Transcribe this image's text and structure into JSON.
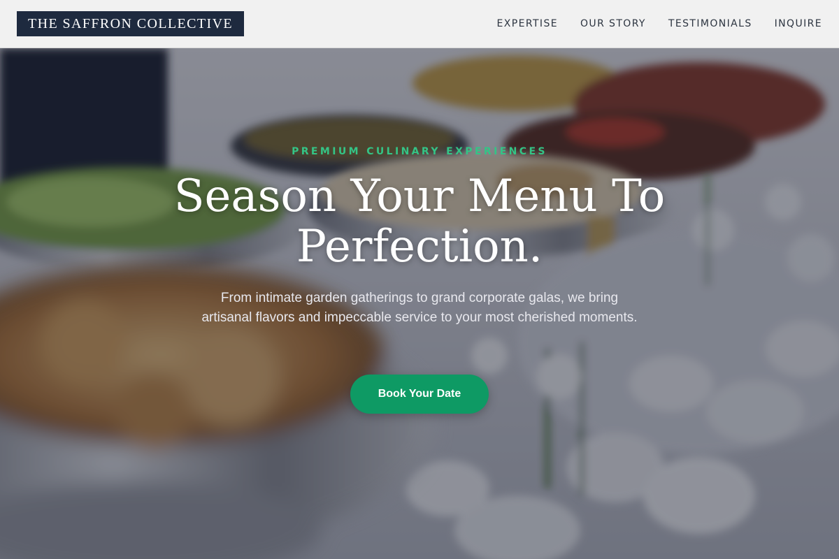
{
  "brand": {
    "name": "THE SAFFRON COLLECTIVE"
  },
  "nav": {
    "items": [
      {
        "label": "EXPERTISE"
      },
      {
        "label": "OUR STORY"
      },
      {
        "label": "TESTIMONIALS"
      },
      {
        "label": "INQUIRE"
      }
    ]
  },
  "hero": {
    "eyebrow": "PREMIUM CULINARY EXPERIENCES",
    "headline": "Season Your Menu To Perfection.",
    "subtext": "From intimate garden gatherings to grand corporate galas, we bring artisanal flavors and impeccable service to your most cherished moments.",
    "cta_label": "Book Your Date"
  },
  "colors": {
    "accent": "#0e9a64",
    "eyebrow": "#34c486",
    "logo_bg": "#1e2a3f",
    "header_bg": "#f1f1f1"
  }
}
